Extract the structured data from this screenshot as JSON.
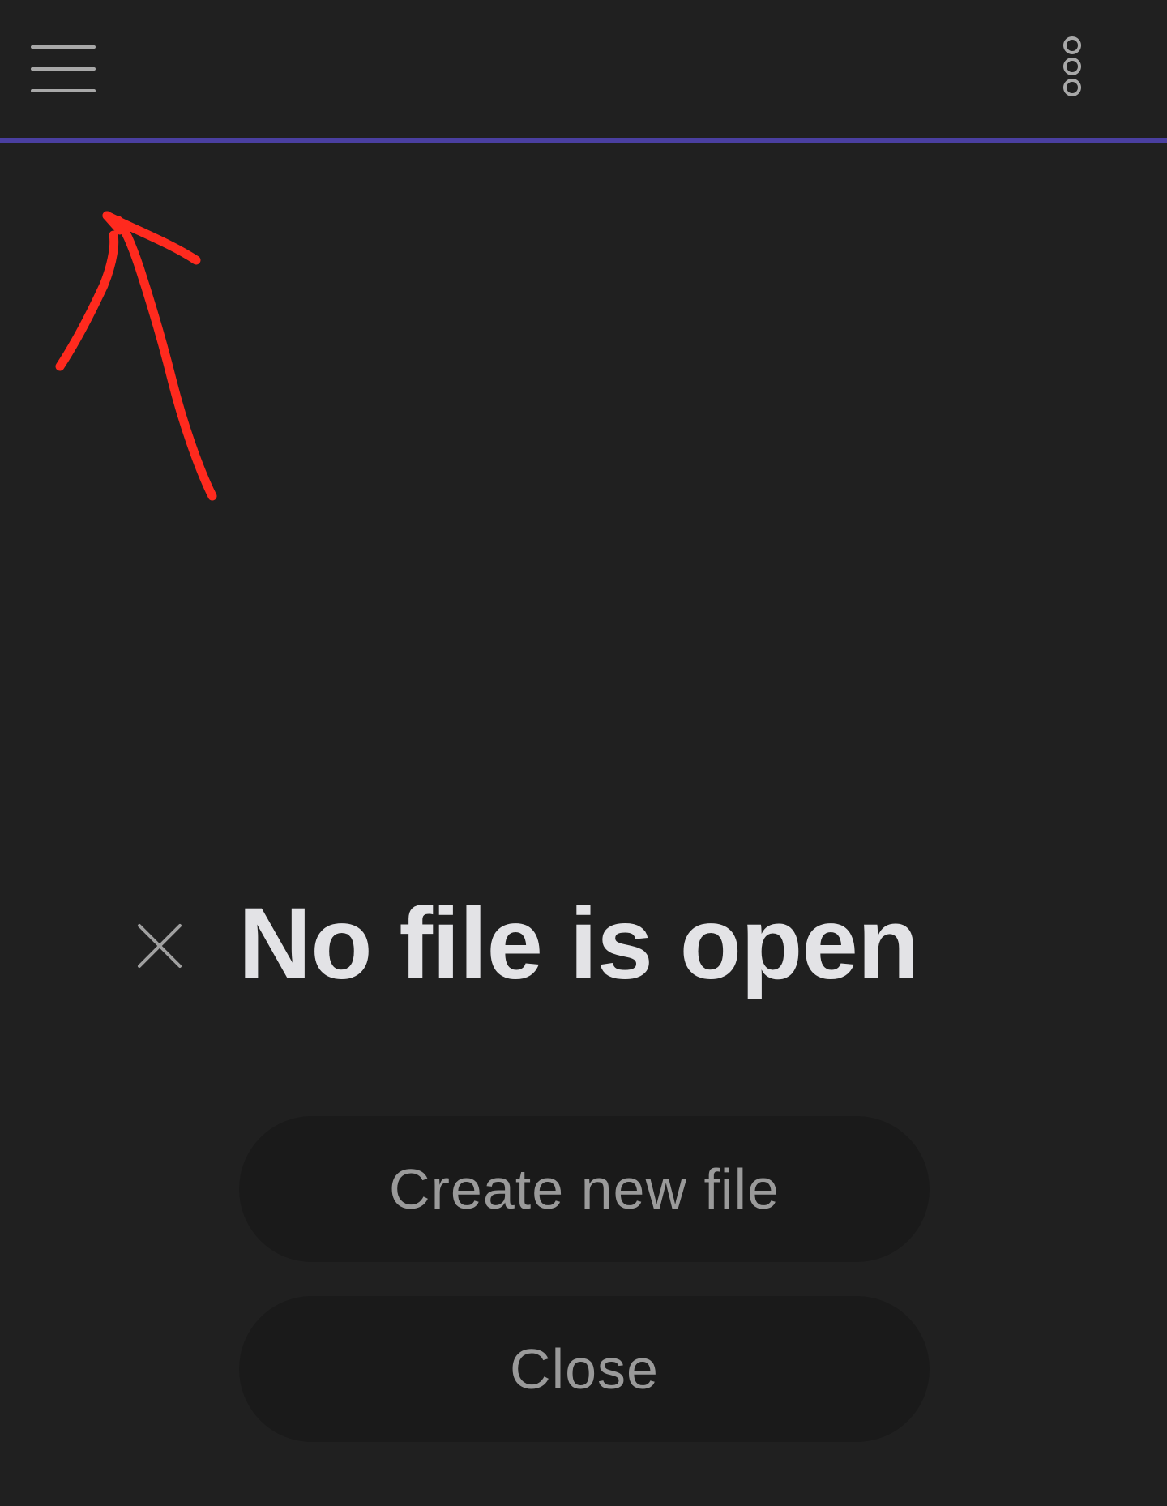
{
  "topbar": {
    "menu_icon": "hamburger-menu-icon",
    "more_icon": "more-vertical-icon",
    "accent_color": "#4a3fa0"
  },
  "annotation": {
    "icon": "red-arrow-annotation",
    "color": "#ff2a1e"
  },
  "empty_state": {
    "dismiss_icon": "close-icon",
    "title": "No file is open",
    "create_label": "Create new file",
    "close_label": "Close"
  },
  "colors": {
    "background": "#202020",
    "button_bg": "#1a1a1a",
    "title_text": "#e3e3e6",
    "button_text": "#9a9a9a"
  }
}
